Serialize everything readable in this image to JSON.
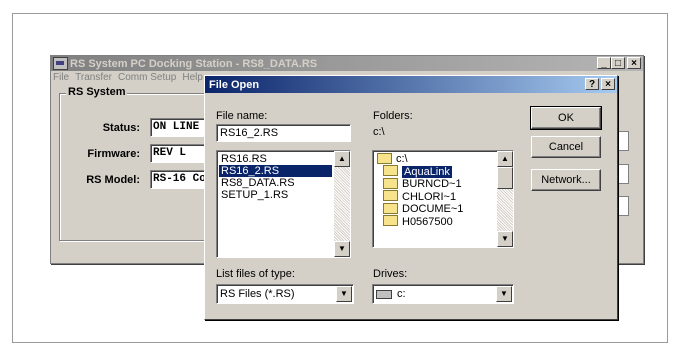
{
  "main_window": {
    "title": "RS System PC Docking Station - RS8_DATA.RS",
    "menu": [
      "File",
      "Transfer",
      "Comm Setup",
      "Help"
    ],
    "group_title": "RS System",
    "fields": [
      {
        "label": "Status:",
        "value": "ON LINE"
      },
      {
        "label": "Firmware:",
        "value": "REV L"
      },
      {
        "label": "RS Model:",
        "value": "RS-16 Combo"
      }
    ]
  },
  "dialog": {
    "title": "File Open",
    "help_btn": "?",
    "close_btn": "×",
    "file_name_label": "File name:",
    "file_name_value": "RS16_2.RS",
    "files": [
      {
        "name": "RS16.RS",
        "selected": false
      },
      {
        "name": "RS16_2.RS",
        "selected": true
      },
      {
        "name": "RS8_DATA.RS",
        "selected": false
      },
      {
        "name": "SETUP_1.RS",
        "selected": false
      }
    ],
    "folders_label": "Folders:",
    "current_path": "c:\\",
    "folders": [
      {
        "name": "c:\\",
        "selected": false,
        "open": true
      },
      {
        "name": "AquaLink",
        "selected": true,
        "open": false
      },
      {
        "name": "BURNCD~1",
        "selected": false,
        "open": false
      },
      {
        "name": "CHLORI~1",
        "selected": false,
        "open": false
      },
      {
        "name": "DOCUME~1",
        "selected": false,
        "open": false
      },
      {
        "name": "H0567500",
        "selected": false,
        "open": false
      }
    ],
    "ok_label": "OK",
    "cancel_label": "Cancel",
    "network_label": "Network...",
    "file_type_label": "List files of type:",
    "file_type_value": "RS Files (*.RS)",
    "drives_label": "Drives:",
    "drive_value": "c:"
  }
}
